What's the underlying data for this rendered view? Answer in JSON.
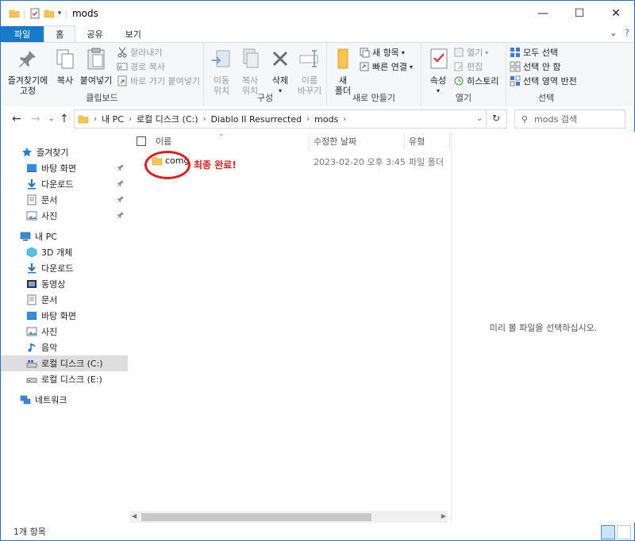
{
  "window": {
    "title": "mods"
  },
  "window_controls": {
    "minimize": "—",
    "maximize": "☐",
    "close": "✕"
  },
  "tabs": {
    "file": "파일",
    "home": "홈",
    "share": "공유",
    "view": "보기"
  },
  "ribbon": {
    "clipboard": {
      "label": "클립보드",
      "pin": "즐겨찾기에\n고정",
      "pin_l1": "즐겨찾기에",
      "pin_l2": "고정",
      "copy": "복사",
      "paste": "붙여넣기",
      "cut": "잘라내기",
      "copy_path": "경로 복사",
      "paste_shortcut": "바로 가기 붙여넣기"
    },
    "organize": {
      "label": "구성",
      "move_l1": "이동",
      "move_l2": "위치",
      "copy_l1": "복사",
      "copy_l2": "위치",
      "delete": "삭제",
      "rename_l1": "이름",
      "rename_l2": "바꾸기"
    },
    "new": {
      "label": "새로 만들기",
      "folder_l1": "새",
      "folder_l2": "폴더",
      "new_item": "새 항목",
      "quick_access": "빠른 연결"
    },
    "open": {
      "label": "열기",
      "properties": "속성",
      "open": "열기",
      "edit": "편집",
      "history": "히스토리"
    },
    "select": {
      "label": "선택",
      "select_all": "모두 선택",
      "select_none": "선택 안 함",
      "invert": "선택 영역 반전"
    }
  },
  "address": {
    "crumbs": [
      "내 PC",
      "로컬 디스크 (C:)",
      "Diablo II Resurrected",
      "mods"
    ],
    "search_placeholder": "mods 검색"
  },
  "nav": {
    "quick_access": "즐겨찾기",
    "qa_items": [
      "바탕 화면",
      "다운로드",
      "문서",
      "사진"
    ],
    "this_pc": "내 PC",
    "pc_items": [
      "3D 개체",
      "다운로드",
      "동영상",
      "문서",
      "바탕 화면",
      "사진",
      "음악",
      "로컬 디스크 (C:)",
      "로컬 디스크 (E:)"
    ],
    "network": "네트워크"
  },
  "columns": {
    "name": "이름",
    "date": "수정한 날짜",
    "type": "유형"
  },
  "files": [
    {
      "name": "comg",
      "date": "2023-02-20 오후 3:45",
      "type": "파일 폴더"
    }
  ],
  "annotation": "최종 완료!",
  "preview_text": "미리 볼 파일을 선택하십시오.",
  "status": {
    "count": "1개 항목"
  },
  "colors": {
    "accent": "#1979ca",
    "annotation": "#e31b1b",
    "folder": "#f5c451"
  }
}
